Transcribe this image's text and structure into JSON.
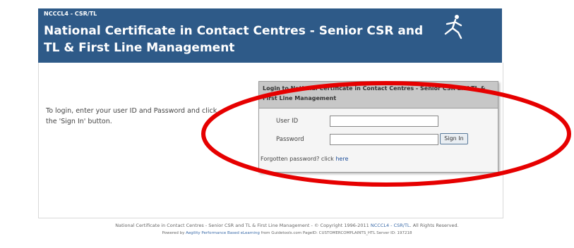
{
  "banner": {
    "code": "NCCCL4 - CSR/TL",
    "title": "National Certificate in Contact Centres - Senior CSR and TL & First Line Management"
  },
  "instructions": "To login, enter your user ID and Password and click the 'Sign In' button.",
  "login": {
    "header": "Login to National Certificate in Contact Centres - Senior CSR and TL & First Line Management",
    "user_id_label": "User ID",
    "user_id_value": "",
    "password_label": "Password",
    "password_value": "",
    "sign_in_label": "Sign In",
    "forgot_text": "Forgotten password? click",
    "forgot_link": "here"
  },
  "footer": {
    "line1_text": "National Certificate in Contact Centres - Senior CSR and TL & First Line Management - © Copyright 1996-2011",
    "line1_link": "NCCCL4 - CSR/TL",
    "line1_end": ". All Rights Reserved.",
    "line2_prefix": "Powered by",
    "line2_link": "Aegility Performance Based eLearning",
    "line2_mid": "from Guidetools.com",
    "line2_page": "PageID: CUSTOMERCOMPLAINTS_HTL Server ID: 197218"
  },
  "colors": {
    "banner": "#2e5a88",
    "annotation": "#e60000"
  }
}
